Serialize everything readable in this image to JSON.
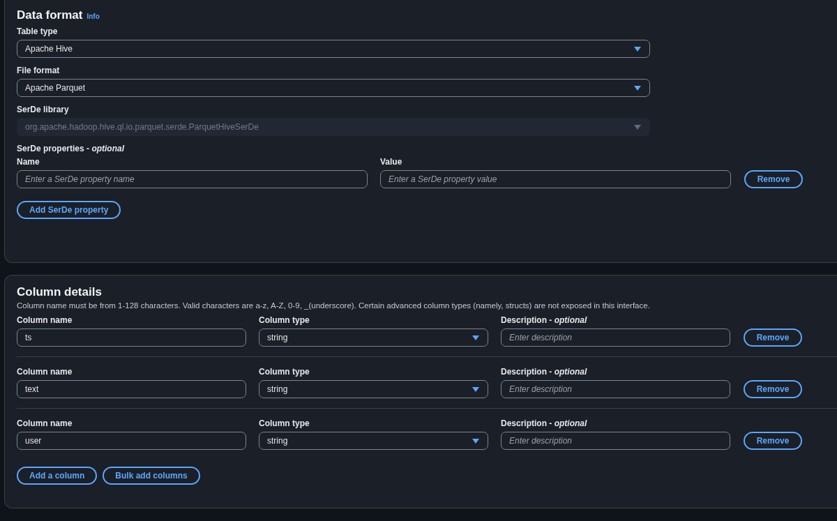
{
  "data_format": {
    "title": "Data format",
    "info_link": "Info",
    "fields": [
      {
        "label": "Table type",
        "kind": "select",
        "value": "Apache Hive",
        "disabled": false
      },
      {
        "label": "File format",
        "kind": "select",
        "value": "Apache Parquet",
        "disabled": false
      },
      {
        "label": "SerDe library",
        "kind": "select",
        "value": "org.apache.hadoop.hive.ql.io.parquet.serde.ParquetHiveSerDe",
        "disabled": true
      }
    ],
    "serde_properties": {
      "label": "SerDe properties - *optional*",
      "rows": [
        {
          "name_label": "Name",
          "name_placeholder": "Enter a SerDe property name",
          "value_label": "Value",
          "value_placeholder": "Enter a SerDe property value",
          "remove": "Remove"
        }
      ],
      "add_button": "Add SerDe property"
    }
  },
  "column_details": {
    "title": "Column details",
    "description": "Column name must be from 1-128 characters. Valid characters are a-z, A-Z, 0-9, _(underscore). Certain advanced column types (namely, structs) are not exposed in this interface.",
    "rows": [
      {
        "name_label": "Column name",
        "name_value": "ts",
        "type_label": "Column type",
        "type_value": "string",
        "description_label": "Description - *optional*",
        "description_placeholder": "Enter description",
        "remove": "Remove"
      },
      {
        "name_label": "Column name",
        "name_value": "text",
        "type_label": "Column type",
        "type_value": "string",
        "description_label": "Description - *optional*",
        "description_placeholder": "Enter description",
        "remove": "Remove"
      },
      {
        "name_label": "Column name",
        "name_value": "user",
        "type_label": "Column type",
        "type_value": "string",
        "description_label": "Description - *optional*",
        "description_placeholder": "Enter description",
        "remove": "Remove"
      }
    ],
    "buttons": [
      "Add a column",
      "Bulk add columns"
    ]
  }
}
